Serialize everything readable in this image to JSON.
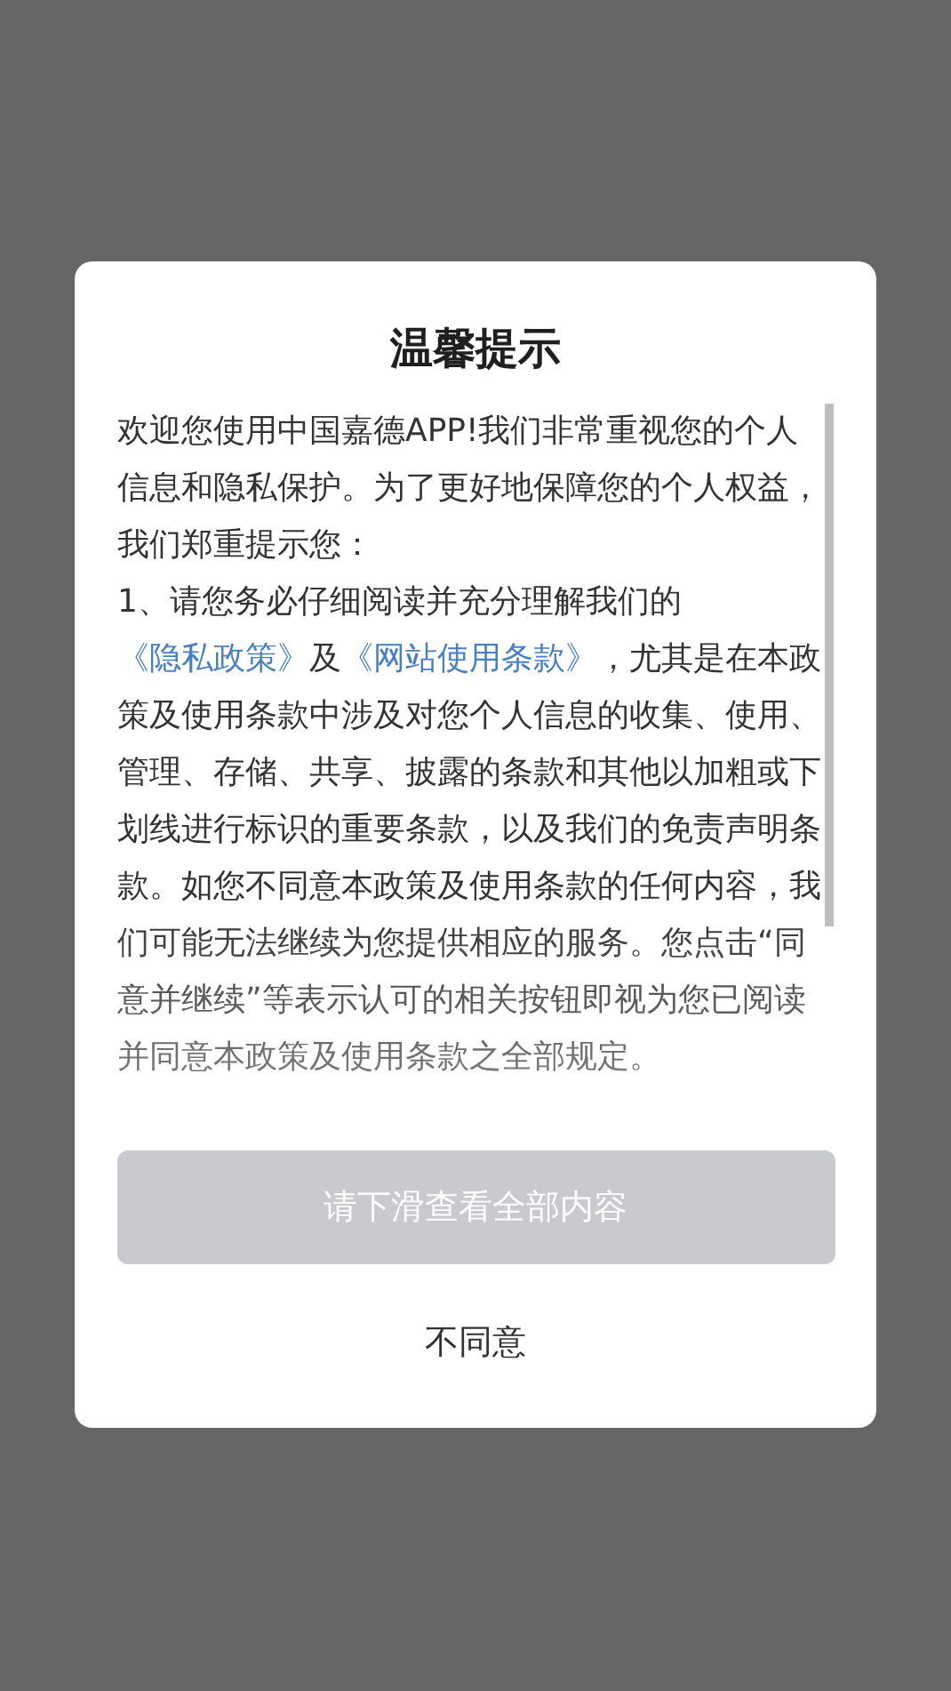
{
  "dialog": {
    "title": "温馨提示",
    "body": [
      {
        "kind": "text",
        "text": "欢迎您使用中国嘉德APP!我们非常重视您的个人信息和隐私保护。为了更好地保障您的个人权益，我们郑重提示您："
      },
      {
        "kind": "break"
      },
      {
        "kind": "text",
        "text": "1、请您务必仔细阅读并充分理解我们的"
      },
      {
        "kind": "link",
        "text": "《隐私政策》"
      },
      {
        "kind": "text",
        "text": "及"
      },
      {
        "kind": "link",
        "text": "《网站使用条款》"
      },
      {
        "kind": "text",
        "text": "，尤其是在本政策及使用条款中涉及对您个人信息的收集、使用、管理、存储、共享、披露的条款和其他以加粗或下划线进行标识的重要条款，以及我们的免责声明条款。如您不同意本政策及使用条款的任何内容，我们可能无法继续为您提供相应的服务。您点击“同意并继续”等表示认可的相关按钮即视为您已阅读并同意本政策及使用条款之全部规定。"
      }
    ],
    "primary_button": {
      "label": "请下滑查看全部内容",
      "disabled": true
    },
    "secondary_button": {
      "label": "不同意"
    }
  }
}
